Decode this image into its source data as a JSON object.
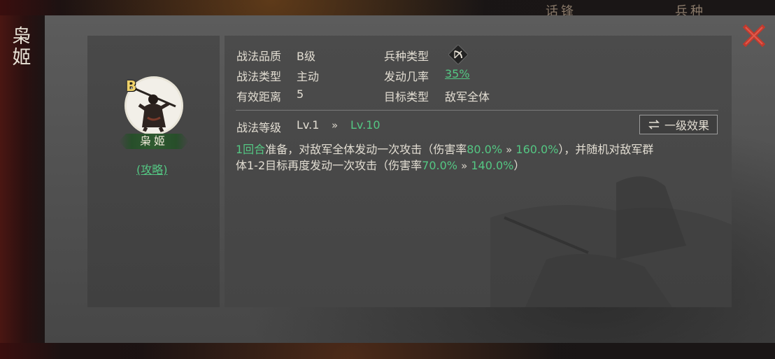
{
  "top_tabs": [
    "话锋",
    "兵种"
  ],
  "general": {
    "name_vertical": [
      "枭",
      "姬"
    ],
    "name": "枭姬",
    "grade": "B",
    "guide_link": "(攻略)"
  },
  "tactic": {
    "quality_label": "战法品质",
    "quality_value": "B级",
    "type_label": "战法类型",
    "type_value": "主动",
    "range_label": "有效距离",
    "range_value": "5",
    "troop_label": "兵种类型",
    "troop_icon": "bow-icon",
    "rate_label": "发动几率",
    "rate_value": "35%",
    "target_label": "目标类型",
    "target_value": "敌军全体"
  },
  "level": {
    "label": "战法等级",
    "from": "Lv.1",
    "arrow": "»",
    "to": "Lv.10",
    "button_label": "一级效果",
    "button_icon": "swap-arrows-icon"
  },
  "description": {
    "line1": {
      "prep_turns": "1回合",
      "t1": "准备，对敌军全体发动一次攻击（伤害率",
      "v1_from": "80.0%",
      "arrow": "»",
      "v1_to": "160.0%",
      "t2": "），并随机对敌军群"
    },
    "line2": {
      "t1": "体1-2目标再度发动一次攻击（伤害率",
      "v2_from": "70.0%",
      "arrow": "»",
      "v2_to": "140.0%",
      "t2": "）"
    }
  },
  "colors": {
    "highlight_green": "#54c783",
    "close_red": "#c23a2e",
    "grade_gold": "#f0d26a"
  }
}
